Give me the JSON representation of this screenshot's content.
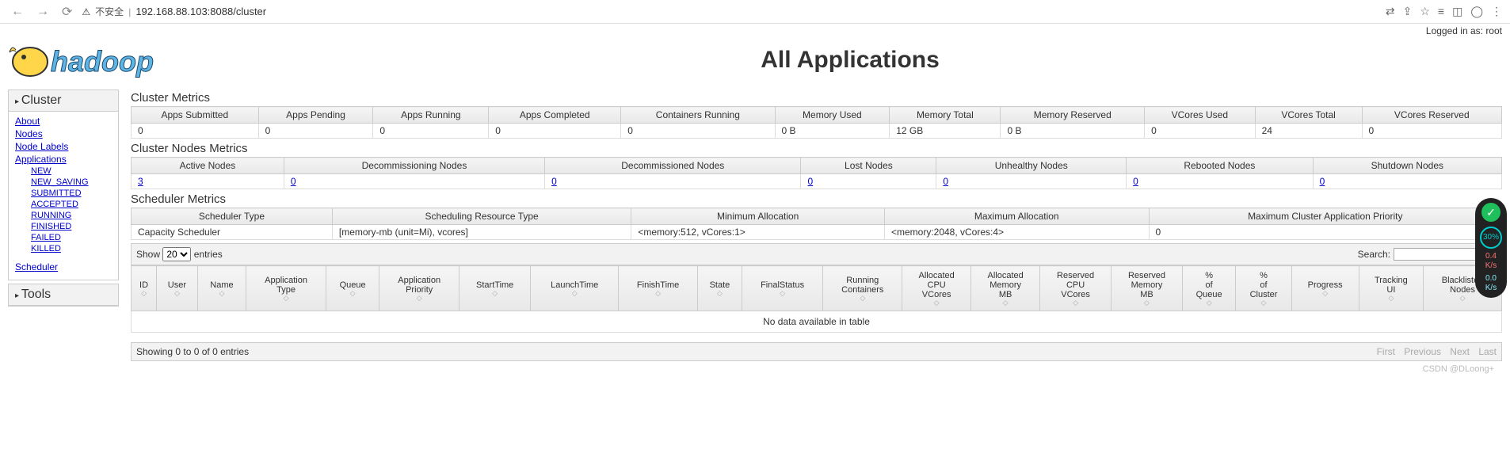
{
  "browser": {
    "insecure_label": "不安全",
    "url": "192.168.88.103:8088/cluster"
  },
  "login_prefix": "Logged in as: ",
  "login_user": "root",
  "page_title": "All Applications",
  "sidebar": {
    "cluster_title": "Cluster",
    "tools_title": "Tools",
    "links": {
      "about": "About",
      "nodes": "Nodes",
      "node_labels": "Node Labels",
      "applications": "Applications",
      "scheduler": "Scheduler"
    },
    "app_states": [
      "NEW",
      "NEW_SAVING",
      "SUBMITTED",
      "ACCEPTED",
      "RUNNING",
      "FINISHED",
      "FAILED",
      "KILLED"
    ]
  },
  "cluster_metrics": {
    "title": "Cluster Metrics",
    "headers": [
      "Apps Submitted",
      "Apps Pending",
      "Apps Running",
      "Apps Completed",
      "Containers Running",
      "Memory Used",
      "Memory Total",
      "Memory Reserved",
      "VCores Used",
      "VCores Total",
      "VCores Reserved"
    ],
    "values": [
      "0",
      "0",
      "0",
      "0",
      "0",
      "0 B",
      "12 GB",
      "0 B",
      "0",
      "24",
      "0"
    ]
  },
  "node_metrics": {
    "title": "Cluster Nodes Metrics",
    "headers": [
      "Active Nodes",
      "Decommissioning Nodes",
      "Decommissioned Nodes",
      "Lost Nodes",
      "Unhealthy Nodes",
      "Rebooted Nodes",
      "Shutdown Nodes"
    ],
    "values": [
      "3",
      "0",
      "0",
      "0",
      "0",
      "0",
      "0"
    ]
  },
  "scheduler_metrics": {
    "title": "Scheduler Metrics",
    "headers": [
      "Scheduler Type",
      "Scheduling Resource Type",
      "Minimum Allocation",
      "Maximum Allocation",
      "Maximum Cluster Application Priority"
    ],
    "values": [
      "Capacity Scheduler",
      "[memory-mb (unit=Mi), vcores]",
      "<memory:512, vCores:1>",
      "<memory:2048, vCores:4>",
      "0"
    ]
  },
  "apps_table": {
    "show_label": "Show",
    "entries_label": "entries",
    "show_value": "20",
    "search_label": "Search:",
    "headers": [
      "ID",
      "User",
      "Name",
      "Application Type",
      "Queue",
      "Application Priority",
      "StartTime",
      "LaunchTime",
      "FinishTime",
      "State",
      "FinalStatus",
      "Running Containers",
      "Allocated CPU VCores",
      "Allocated Memory MB",
      "Reserved CPU VCores",
      "Reserved Memory MB",
      "% of Queue",
      "% of Cluster",
      "Progress",
      "Tracking UI",
      "Blacklisted Nodes"
    ],
    "no_data": "No data available in table",
    "footer_info": "Showing 0 to 0 of 0 entries",
    "paging": {
      "first": "First",
      "prev": "Previous",
      "next": "Next",
      "last": "Last"
    }
  },
  "watermark": "CSDN @DLoong+",
  "widget": {
    "percent": "30%",
    "rate1": "0.4",
    "rate1u": "K/s",
    "rate2": "0.0",
    "rate2u": "K/s"
  }
}
